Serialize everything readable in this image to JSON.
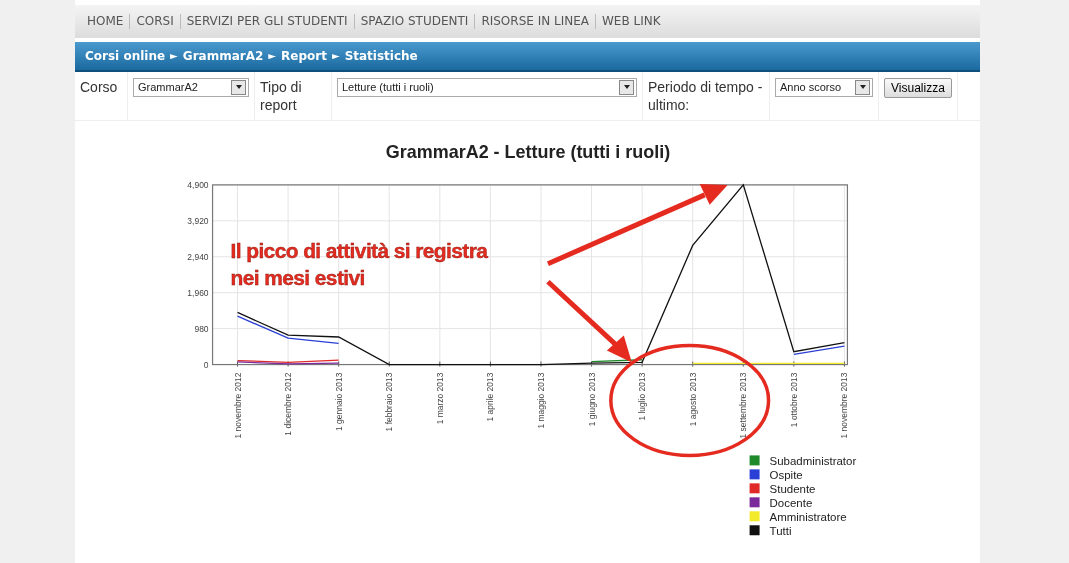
{
  "nav": [
    "HOME",
    "CORSI",
    "SERVIZI PER GLI STUDENTI",
    "SPAZIO STUDENTI",
    "RISORSE IN LINEA",
    "WEB LINK"
  ],
  "breadcrumb": {
    "items": [
      "Corsi online",
      "GrammarA2",
      "Report",
      "Statistiche"
    ],
    "separator": "►"
  },
  "form": {
    "fields": [
      {
        "label": "Corso",
        "value": "GrammarA2"
      },
      {
        "label": "Tipo di report",
        "value": "Letture (tutti i ruoli)"
      },
      {
        "label": "Periodo di tempo - ultimo:",
        "value": "Anno scorso"
      }
    ],
    "button": "Visualizza"
  },
  "chart_data": {
    "type": "line",
    "title": "GrammarA2 - Letture (tutti i ruoli)",
    "categories": [
      "1 novembre 2012",
      "1 dicembre 2012",
      "1 gennaio 2013",
      "1 febbraio 2013",
      "1 marzo 2013",
      "1 aprile 2013",
      "1 maggio 2013",
      "1 giugno 2013",
      "1 luglio 2013",
      "1 agosto 2013",
      "1 settembre 2013",
      "1 ottobre 2013",
      "1 novembre 2013"
    ],
    "ylim": [
      0,
      4900
    ],
    "yticks": [
      {
        "value": 0,
        "label": "0"
      },
      {
        "value": 980,
        "label": "980"
      },
      {
        "value": 1960,
        "label": "1,960"
      },
      {
        "value": 2940,
        "label": "2,940"
      },
      {
        "value": 3920,
        "label": "3,920"
      },
      {
        "value": 4900,
        "label": "4,900"
      }
    ],
    "series": [
      {
        "name": "Subadministrator",
        "color": "#1f8a2a",
        "values": [
          null,
          null,
          null,
          null,
          null,
          null,
          null,
          80,
          130,
          null,
          null,
          null,
          null
        ]
      },
      {
        "name": "Ospite",
        "color": "#2a3fd6",
        "values": [
          1320,
          720,
          580,
          null,
          null,
          null,
          null,
          null,
          null,
          null,
          null,
          280,
          500
        ]
      },
      {
        "name": "Studente",
        "color": "#e02a2a",
        "values": [
          110,
          60,
          120,
          null,
          null,
          null,
          null,
          null,
          null,
          null,
          null,
          null,
          null
        ]
      },
      {
        "name": "Docente",
        "color": "#7a2a9a",
        "values": [
          70,
          20,
          40,
          null,
          null,
          null,
          null,
          null,
          null,
          null,
          null,
          null,
          null
        ]
      },
      {
        "name": "Amministratore",
        "color": "#f2ea2a",
        "values": [
          null,
          null,
          null,
          null,
          null,
          null,
          null,
          null,
          null,
          30,
          30,
          30,
          30
        ]
      },
      {
        "name": "Tutti",
        "color": "#111111",
        "values": [
          1420,
          800,
          750,
          0,
          0,
          0,
          0,
          40,
          60,
          3250,
          4900,
          350,
          600
        ]
      }
    ],
    "grid": true,
    "legend": true,
    "annotations": [
      {
        "text": "Il picco di attività si registra\nnei mesi estivi"
      }
    ]
  }
}
